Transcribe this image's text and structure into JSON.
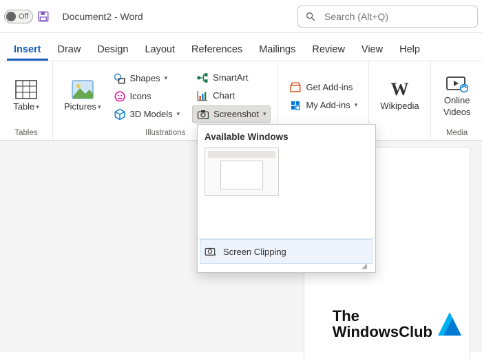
{
  "titlebar": {
    "autosave_toggle": "Off",
    "document_title": "Document2  -  Word"
  },
  "search": {
    "placeholder": "Search (Alt+Q)"
  },
  "tabs": [
    "Insert",
    "Draw",
    "Design",
    "Layout",
    "References",
    "Mailings",
    "Review",
    "View",
    "Help"
  ],
  "active_tab": "Insert",
  "ribbon": {
    "groups": {
      "tables": {
        "label": "Tables",
        "table": "Table"
      },
      "illustrations": {
        "label": "Illustrations",
        "pictures": "Pictures",
        "shapes": "Shapes",
        "icons": "Icons",
        "models": "3D Models",
        "smartart": "SmartArt",
        "chart": "Chart",
        "screenshot": "Screenshot"
      },
      "addins": {
        "get": "Get Add-ins",
        "my": "My Add-ins"
      },
      "wikipedia": {
        "label": "Wikipedia"
      },
      "media": {
        "label": "Media",
        "videos_line1": "Online",
        "videos_line2": "Videos"
      }
    }
  },
  "dropdown": {
    "heading": "Available Windows",
    "screen_clipping": "Screen Clipping"
  },
  "watermark": {
    "line1": "The",
    "line2": "WindowsClub"
  }
}
